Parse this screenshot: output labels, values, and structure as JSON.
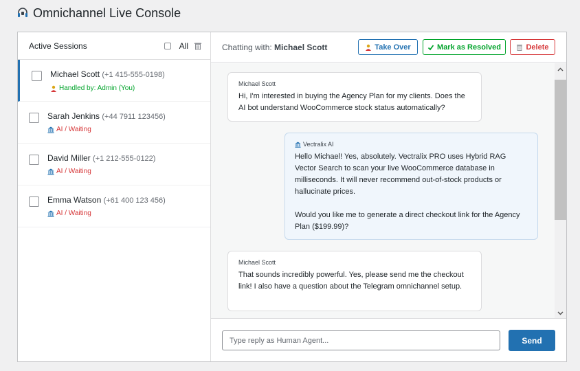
{
  "page": {
    "title": "Omnichannel Live Console",
    "icon": "headset-icon"
  },
  "sidebar": {
    "title": "Active Sessions",
    "select_all_label": "All",
    "sessions": [
      {
        "name": "Michael Scott",
        "phone": "(+1 415-555-0198)",
        "status": "Handled by: Admin (You)",
        "status_icon": "agent-icon",
        "state": "handled",
        "active": true
      },
      {
        "name": "Sarah Jenkins",
        "phone": "(+44 7911 123456)",
        "status": "AI / Waiting",
        "status_icon": "bank-icon",
        "state": "waiting",
        "active": false
      },
      {
        "name": "David Miller",
        "phone": "(+1 212-555-0122)",
        "status": "AI / Waiting",
        "status_icon": "bank-icon",
        "state": "waiting",
        "active": false
      },
      {
        "name": "Emma Watson",
        "phone": "(+61 400 123 456)",
        "status": "AI / Waiting",
        "status_icon": "bank-icon",
        "state": "waiting",
        "active": false
      }
    ]
  },
  "chat": {
    "chatting_label": "Chatting with:",
    "chatting_name": "Michael Scott",
    "buttons": {
      "takeover": "Take Over",
      "resolve": "Mark as Resolved",
      "delete": "Delete"
    },
    "messages": [
      {
        "sender": "Michael Scott",
        "role": "user",
        "text": "Hi, I'm interested in buying the Agency Plan for my clients. Does the AI bot understand WooCommerce stock status automatically?"
      },
      {
        "sender": "Vectralix AI",
        "role": "ai",
        "text": "Hello Michael! Yes, absolutely. Vectralix PRO uses Hybrid RAG Vector Search to scan your live WooCommerce database in milliseconds. It will never recommend out-of-stock products or hallucinate prices.",
        "text2": "Would you like me to generate a direct checkout link for the Agency Plan ($199.99)?"
      },
      {
        "sender": "Michael Scott",
        "role": "user",
        "text": "That sounds incredibly powerful. Yes, please send me the checkout link! I also have a question about the Telegram omnichannel setup."
      }
    ],
    "composer": {
      "placeholder": "Type reply as Human Agent...",
      "send_label": "Send"
    }
  },
  "colors": {
    "primary": "#2271b1",
    "success": "#00a32a",
    "danger": "#d63638",
    "ai_bubble": "#f0f6fc"
  }
}
